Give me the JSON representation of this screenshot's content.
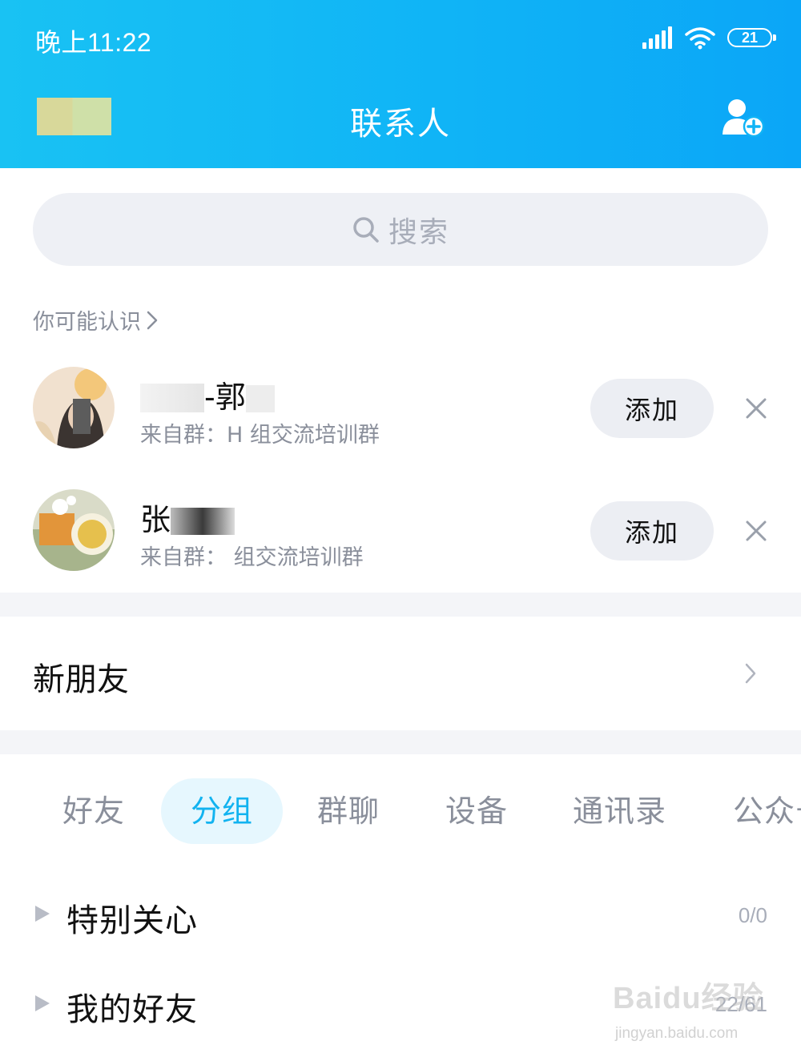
{
  "status_bar": {
    "time": "晚上11:22",
    "battery": "21"
  },
  "header": {
    "title": "联系人",
    "bg_color": "#10b4f6"
  },
  "search": {
    "placeholder": "搜索"
  },
  "may_know": {
    "title": "你可能认识",
    "suggestions": [
      {
        "name": "-郭",
        "source": "来自群：H    组交流培训群",
        "add_label": "添加"
      },
      {
        "name": "张",
        "source": "来自群：    组交流培训群",
        "add_label": "添加"
      }
    ]
  },
  "new_friends": {
    "label": "新朋友"
  },
  "tabs": [
    {
      "label": "好友",
      "active": false
    },
    {
      "label": "分组",
      "active": true
    },
    {
      "label": "群聊",
      "active": false
    },
    {
      "label": "设备",
      "active": false
    },
    {
      "label": "通讯录",
      "active": false
    },
    {
      "label": "公众号",
      "active": false
    }
  ],
  "groups": [
    {
      "name": "特别关心",
      "count": "0/0"
    },
    {
      "name": "我的好友",
      "count": "22/61"
    }
  ],
  "watermark": {
    "brand": "Baidu经验",
    "url": "jingyan.baidu.com"
  },
  "colors": {
    "accent": "#12b3f0",
    "accent_bg": "#e6f7fe",
    "muted_text": "#8a8f9b"
  }
}
